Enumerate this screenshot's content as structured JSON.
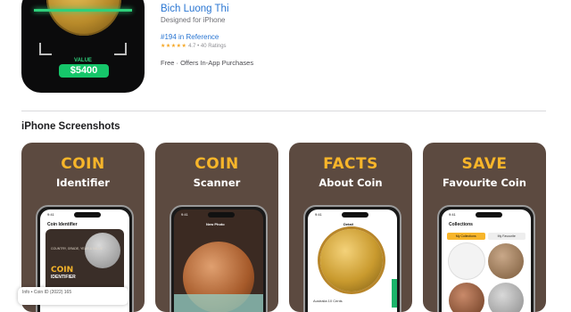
{
  "app": {
    "developer": "Bich Luong Thi",
    "designed_for": "Designed for iPhone",
    "rank": "#194 in Reference",
    "rating_stars": "★★★★★",
    "rating_text": "4.7 • 40 Ratings",
    "price": "Free · Offers In-App Purchases"
  },
  "icon": {
    "value_label": "VALUE",
    "value_amount": "$5400"
  },
  "section": {
    "title": "iPhone Screenshots"
  },
  "screenshots": [
    {
      "headline": "COIN",
      "subhead": "Identifier",
      "screen_title": "Coin Identifier",
      "badge_main": "COIN",
      "badge_sub": "IDENTIFIER",
      "caption": "COUNTRY, GRADE, YEAR & VALUE"
    },
    {
      "headline": "COIN",
      "subhead": "Scanner",
      "screen_title": "New Photo"
    },
    {
      "headline": "FACTS",
      "subhead": "About Coin",
      "screen_title": "Detail",
      "coin_label": "Australia 10 Cents"
    },
    {
      "headline": "SAVE",
      "subhead": "Favourite Coin",
      "screen_title": "Collections",
      "tab_1": "My Collections",
      "tab_2": "My Favourite"
    }
  ],
  "status_time": "9:41",
  "overlay_text": "Info • Coin ID (2022) 165"
}
